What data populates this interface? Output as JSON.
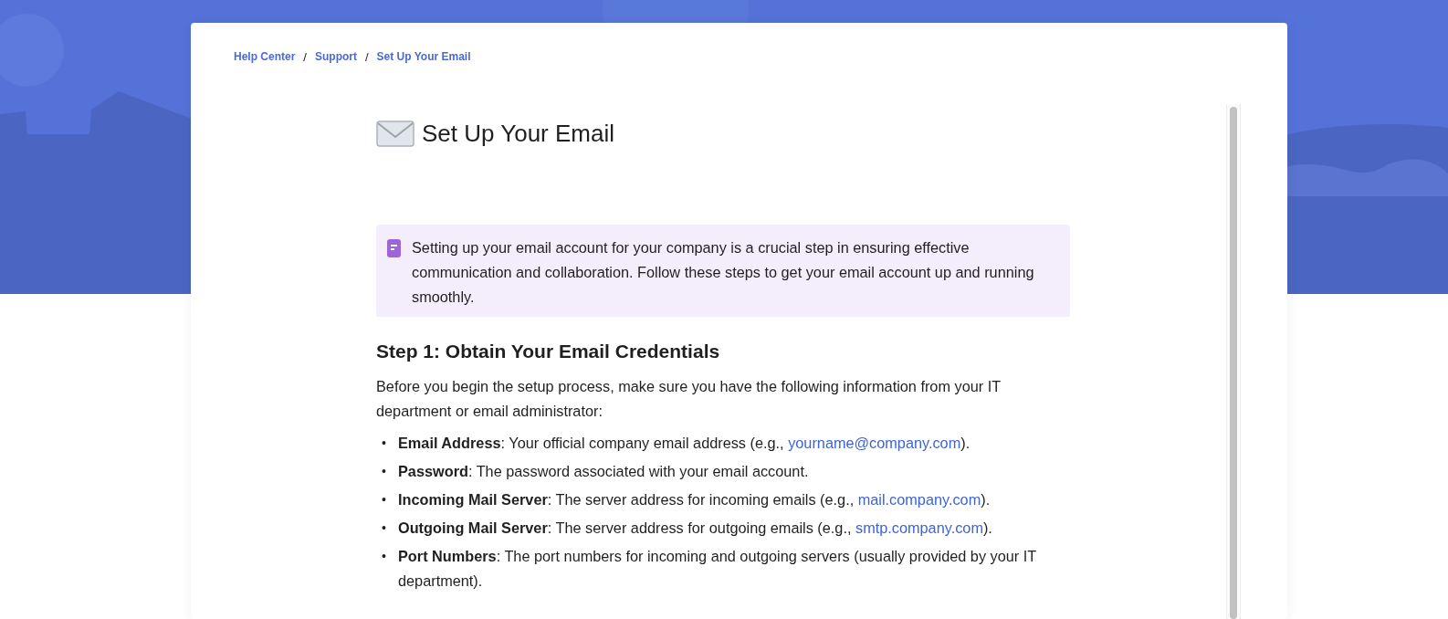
{
  "breadcrumb": [
    {
      "label": "Help Center"
    },
    {
      "label": "Support"
    },
    {
      "label": "Set Up Your Email"
    }
  ],
  "breadcrumb_separator": "/",
  "bullet": "•",
  "title": "Set Up Your Email",
  "callout": {
    "text": "Setting up your email account for your company is a crucial step in ensuring effective communication and collaboration. Follow these steps to get your email account up and running smoothly."
  },
  "sections": [
    {
      "heading": "Step 1: Obtain Your Email Credentials",
      "intro": "Before you begin the setup process, make sure you have the following information from your IT department or email administrator:",
      "items": [
        {
          "text": "**Email Address**: Your official company email address (e.g., ",
          "link": "yourname@company.com",
          "after": ")."
        },
        {
          "text": "**Password**: The password associated with your email account."
        },
        {
          "text": "**Incoming Mail Server**: The server address for incoming emails (e.g., ",
          "link": "mail.company.com",
          "after": ")."
        },
        {
          "text": "**Outgoing Mail Server**: The server address for outgoing emails (e.g., ",
          "link": "smtp.company.com",
          "after": ")."
        },
        {
          "text": "**Port Numbers**: The port numbers for incoming and outgoing servers (usually provided by your IT department)."
        }
      ]
    }
  ]
}
